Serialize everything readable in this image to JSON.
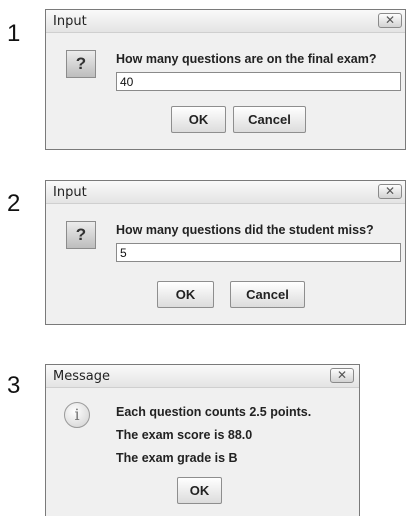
{
  "steps": [
    {
      "number": "1",
      "title": "Input",
      "close_glyph": "✕",
      "icon": "question-icon",
      "prompt": "How many questions are on the final exam?",
      "value": "40",
      "ok_label": "OK",
      "cancel_label": "Cancel"
    },
    {
      "number": "2",
      "title": "Input",
      "close_glyph": "✕",
      "icon": "question-icon",
      "prompt": "How many questions did the student miss?",
      "value": "5",
      "ok_label": "OK",
      "cancel_label": "Cancel"
    },
    {
      "number": "3",
      "title": "Message",
      "close_glyph": "✕",
      "icon": "info-icon",
      "lines": [
        "Each question counts 2.5 points.",
        "The exam score is 88.0",
        "The exam grade is B"
      ],
      "ok_label": "OK"
    }
  ]
}
